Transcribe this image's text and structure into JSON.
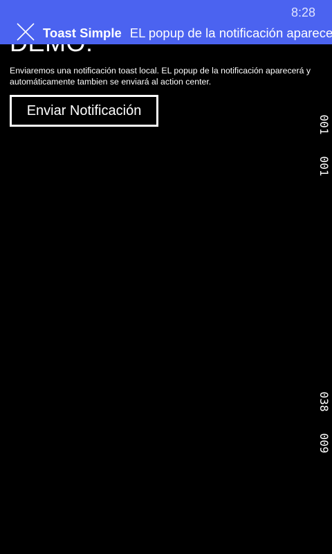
{
  "status_bar": {
    "time": "8:28"
  },
  "toast": {
    "icon": "close-x-icon",
    "title": "Toast Simple",
    "message": "EL popup de la notificación aparecerá",
    "background_color": "#4b63f0"
  },
  "page": {
    "title": "DEMO:",
    "description": "Enviaremos una notificación toast local. EL popup de la notificación aparecerá y automáticamente tambien se enviará al action center.",
    "send_button_label": "Enviar Notificación"
  },
  "frame_counters": {
    "top_first": "001",
    "top_second": "001",
    "bottom_first": "038",
    "bottom_second": "009"
  }
}
